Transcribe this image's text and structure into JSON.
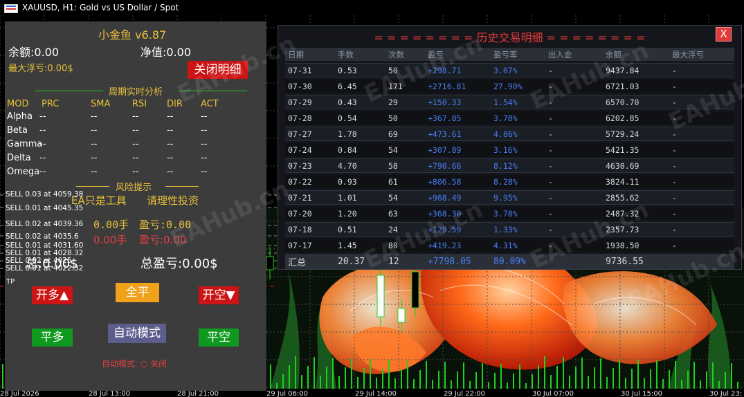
{
  "window": {
    "title": "XAUUSD, H1:  Gold vs US Dollar / Spot"
  },
  "panel": {
    "title": "小金鱼 v6.87",
    "balance": "余额:0.00",
    "equity": "净值:0.00",
    "max_float": "最大浮亏:0.00$",
    "close_detail_btn": "关闭明细",
    "analysis_title": "周期实时分析",
    "headers": [
      "MOD",
      "PRC",
      "SMA",
      "RSI",
      "DIR",
      "ACT"
    ],
    "rows": [
      {
        "name": "Alpha",
        "prc": "--",
        "sma": "--",
        "rsi": "--",
        "dir": "--",
        "act": "--"
      },
      {
        "name": "Beta",
        "prc": "--",
        "sma": "--",
        "rsi": "--",
        "dir": "--",
        "act": "--"
      },
      {
        "name": "Gamma",
        "prc": "--",
        "sma": "--",
        "rsi": "--",
        "dir": "--",
        "act": "--"
      },
      {
        "name": "Delta",
        "prc": "--",
        "sma": "--",
        "rsi": "--",
        "dir": "--",
        "act": "--"
      },
      {
        "name": "Omega",
        "prc": "--",
        "sma": "--",
        "rsi": "--",
        "dir": "--",
        "act": "--"
      }
    ],
    "risk_title": "风险提示",
    "risk_left": "EA只是工具",
    "risk_right": "请理性投资",
    "buy_lots": "0.00手",
    "buy_profit": "盈亏:0.00",
    "sell_lots": "0.00手",
    "sell_profit": "盈亏:0.00",
    "total_label1": "总:0.00$",
    "total_label2": "总盈亏:0.00$",
    "btn_open_long": "开多▲",
    "btn_close_all": "全平",
    "btn_open_short": "开空▼",
    "btn_close_long": "平多",
    "btn_auto_mode": "自动模式",
    "btn_close_short": "平空",
    "auto_status": "自动模式: ○ 关闭"
  },
  "order_lines": [
    "SELL 0.03 at 4059.38",
    "SELL 0.01 at 4045.35",
    "SELL 0.02 at 4039.36",
    "SELL 0.02 at 4035.6",
    "SELL 0.01 at 4031.60",
    "SELL 0.01 at 4028.32",
    "SELL 0.02 at 4025",
    "SELL 0.01 at 4022.32"
  ],
  "tp_label": "TP",
  "history": {
    "title": "= = = = = = = = 历史交易明细 = = = = = = = =",
    "close_btn": "X",
    "columns": [
      "日期",
      "手数",
      "次数",
      "盈亏",
      "盈亏率",
      "出入金",
      "余额",
      "最大浮亏"
    ],
    "rows": [
      [
        "07-31",
        "0.53",
        "50",
        "+298.71",
        "3.07%",
        "-",
        "9437.84",
        "-"
      ],
      [
        "07-30",
        "6.45",
        "171",
        "+2716.81",
        "27.90%",
        "-",
        "6721.03",
        "-"
      ],
      [
        "07-29",
        "0.43",
        "29",
        "+150.33",
        "1.54%",
        "-",
        "6570.70",
        "-"
      ],
      [
        "07-28",
        "0.54",
        "50",
        "+367.85",
        "3.78%",
        "-",
        "6202.85",
        "-"
      ],
      [
        "07-27",
        "1.78",
        "69",
        "+473.61",
        "4.86%",
        "-",
        "5729.24",
        "-"
      ],
      [
        "07-24",
        "0.84",
        "54",
        "+307.89",
        "3.16%",
        "-",
        "5421.35",
        "-"
      ],
      [
        "07-23",
        "4.70",
        "58",
        "+790.66",
        "8.12%",
        "-",
        "4630.69",
        "-"
      ],
      [
        "07-22",
        "0.93",
        "61",
        "+806.58",
        "8.28%",
        "-",
        "3824.11",
        "-"
      ],
      [
        "07-21",
        "1.01",
        "54",
        "+968.49",
        "9.95%",
        "-",
        "2855.62",
        "-"
      ],
      [
        "07-20",
        "1.20",
        "63",
        "+368.30",
        "3.78%",
        "-",
        "2487.32",
        "-"
      ],
      [
        "07-18",
        "0.51",
        "24",
        "+129.59",
        "1.33%",
        "-",
        "2357.73",
        "-"
      ],
      [
        "07-17",
        "1.45",
        "80",
        "+419.23",
        "4.31%",
        "-",
        "1938.50",
        "-"
      ]
    ],
    "summary": [
      "汇总",
      "20.37",
      "12",
      "+7798.05",
      "80.09%",
      "",
      "9736.55",
      ""
    ]
  },
  "watermark": "EAHub.cn",
  "xaxis": [
    "28 Jul 2026",
    "28 Jul 13:00",
    "28 Jul 21:00",
    "29 Jul 06:00",
    "29 Jul 14:00",
    "29 Jul 22:00",
    "30 Jul 07:00",
    "30 Jul 15:00",
    "30 Jul 23:"
  ],
  "colors": {
    "panel_bg": "#3c3c3c",
    "gold": "#e8c13a",
    "red_btn": "#cc1414",
    "green_btn": "#0f9a1f",
    "orange_btn": "#f0a01a",
    "purple_btn": "#5d5d8c",
    "profit_blue": "#4a7df0",
    "line_green": "#1fd01f"
  }
}
